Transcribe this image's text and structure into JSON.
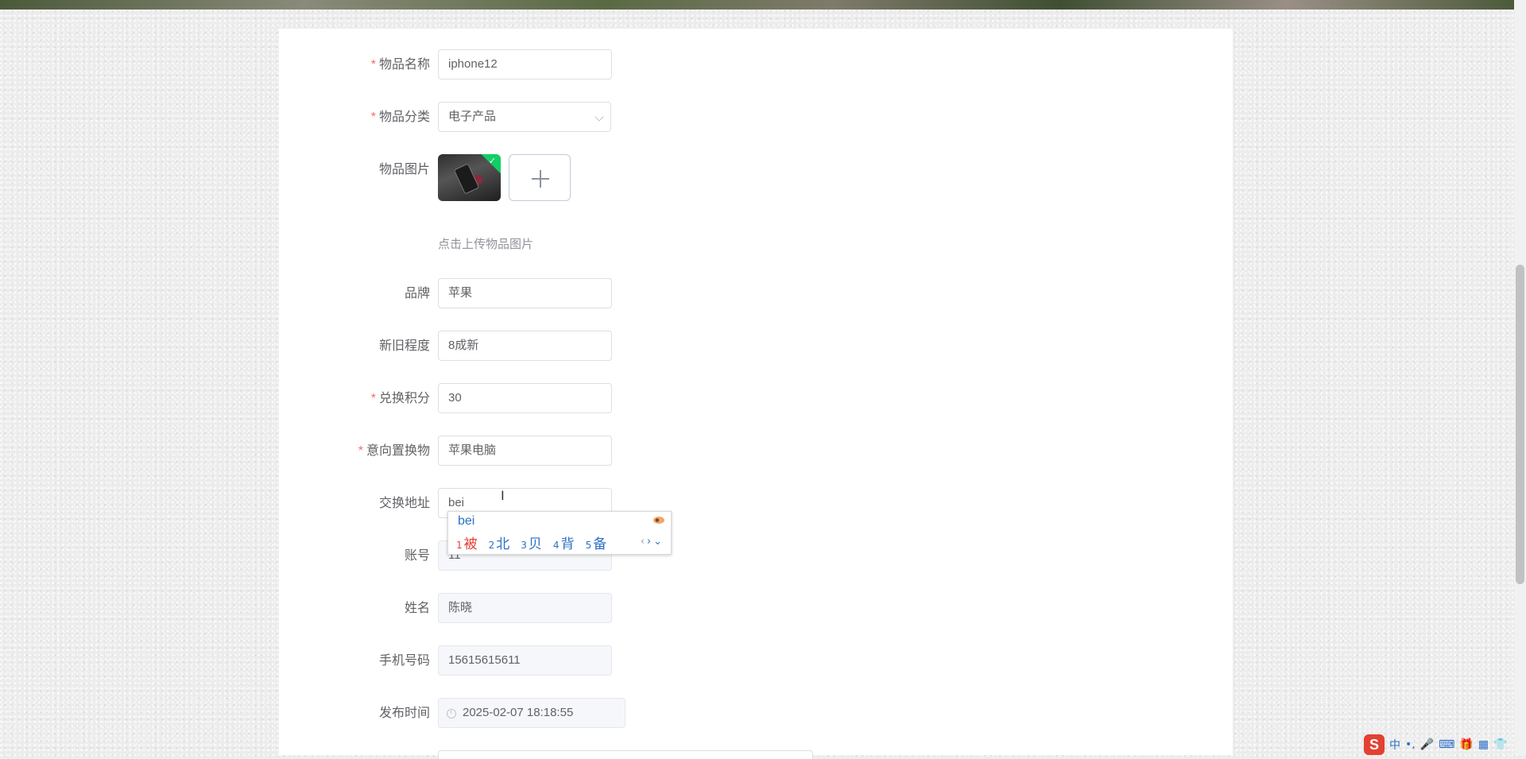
{
  "form": {
    "item_name": {
      "label": "物品名称",
      "value": "iphone12",
      "required": "*"
    },
    "category": {
      "label": "物品分类",
      "value": "电子产品",
      "required": "*"
    },
    "image": {
      "label": "物品图片",
      "tip": "点击上传物品图片"
    },
    "brand": {
      "label": "品牌",
      "value": "苹果"
    },
    "condition": {
      "label": "新旧程度",
      "value": "8成新"
    },
    "points": {
      "label": "兑换积分",
      "value": "30",
      "required": "*"
    },
    "intended_swap": {
      "label": "意向置换物",
      "value": "苹果电脑",
      "required": "*"
    },
    "address": {
      "label": "交换地址",
      "value": "bei"
    },
    "account": {
      "label": "账号",
      "value": "11"
    },
    "name": {
      "label": "姓名",
      "value": "陈晓"
    },
    "phone": {
      "label": "手机号码",
      "value": "15615615611"
    },
    "publish_time": {
      "label": "发布时间",
      "value": "2025-02-07 18:18:55"
    }
  },
  "ime": {
    "pinyin": "bei",
    "candidates": [
      {
        "num": "1",
        "char": "被"
      },
      {
        "num": "2",
        "char": "北"
      },
      {
        "num": "3",
        "char": "贝"
      },
      {
        "num": "4",
        "char": "背"
      },
      {
        "num": "5",
        "char": "备"
      }
    ]
  },
  "tray": {
    "logo": "S",
    "items": [
      "中",
      "•,",
      "🎤",
      "⌨",
      "🎁",
      "▦",
      "👕"
    ]
  },
  "colors": {
    "required": "#f56c6c",
    "ime_blue": "#2c6fc6",
    "ime_red": "#e33e33"
  }
}
